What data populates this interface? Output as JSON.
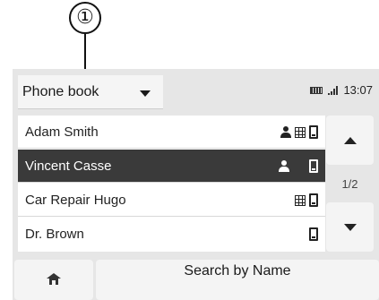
{
  "callout": {
    "number": "①"
  },
  "header": {
    "dropdown_label": "Phone book",
    "time": "13:07"
  },
  "contacts": [
    {
      "name": "Adam Smith",
      "selected": false,
      "icons": [
        "person-icon",
        "grid-icon",
        "phone-icon"
      ]
    },
    {
      "name": "Vincent Casse",
      "selected": true,
      "icons": [
        "person-icon",
        "phone-icon"
      ]
    },
    {
      "name": "Car Repair Hugo",
      "selected": false,
      "icons": [
        "grid-icon",
        "phone-icon"
      ]
    },
    {
      "name": "Dr. Brown",
      "selected": false,
      "icons": [
        "phone-icon"
      ]
    }
  ],
  "pagination": {
    "page": "1/2"
  },
  "footer": {
    "search_label": "Search by Name"
  },
  "colors": {
    "selected_row": "#3a3a3a",
    "screen_bg": "#e6e6e6",
    "button_bg": "#f4f4f4"
  }
}
